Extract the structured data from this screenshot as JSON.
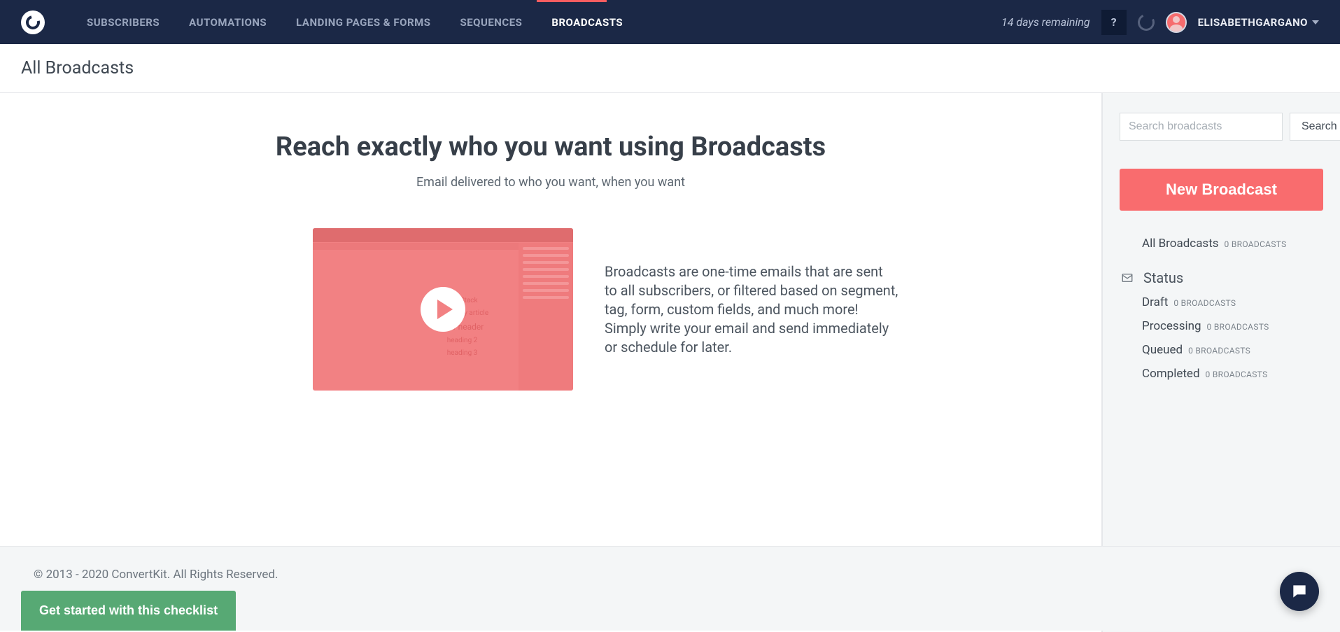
{
  "nav": {
    "items": [
      {
        "label": "SUBSCRIBERS"
      },
      {
        "label": "AUTOMATIONS"
      },
      {
        "label": "LANDING PAGES & FORMS"
      },
      {
        "label": "SEQUENCES"
      },
      {
        "label": "BROADCASTS"
      }
    ],
    "active_index": 4,
    "trial": "14 days remaining",
    "help": "?",
    "username": "ELISABETHGARGANO"
  },
  "page": {
    "title": "All Broadcasts"
  },
  "hero": {
    "title": "Reach exactly who you want using Broadcasts",
    "subtitle": "Email delivered to who you want, when you want",
    "body": "Broadcasts are one-time emails that are sent to all subscribers, or filtered based on segment, tag, form, custom fields, and much more! Simply write your email and send immediately or schedule for later.",
    "thumb_lines": [
      "The Stack",
      "This is my article",
      "new header",
      "heading 2",
      "heading 3"
    ]
  },
  "sidebar": {
    "search_placeholder": "Search broadcasts",
    "search_button": "Search",
    "new_button": "New Broadcast",
    "all_label": "All Broadcasts",
    "all_count": "0 BROADCASTS",
    "status_label": "Status",
    "statuses": [
      {
        "label": "Draft",
        "count": "0 BROADCASTS"
      },
      {
        "label": "Processing",
        "count": "0 BROADCASTS"
      },
      {
        "label": "Queued",
        "count": "0 BROADCASTS"
      },
      {
        "label": "Completed",
        "count": "0 BROADCASTS"
      }
    ]
  },
  "footer": {
    "copyright": "© 2013 - 2020 ConvertKit. All Rights Reserved.",
    "checklist_button": "Get started with this checklist"
  }
}
